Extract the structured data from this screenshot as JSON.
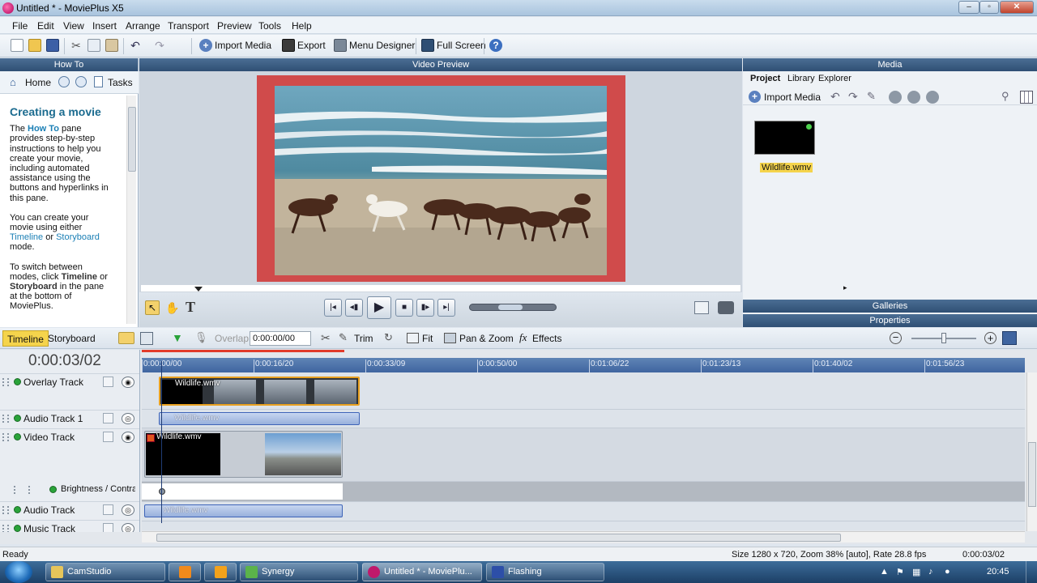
{
  "window": {
    "title": "Untitled * - MoviePlus X5",
    "min": "–",
    "max": "▫",
    "close": "✕"
  },
  "menu": [
    "File",
    "Edit",
    "View",
    "Insert",
    "Arrange",
    "Transport",
    "Preview",
    "Tools",
    "Help"
  ],
  "toolbar": {
    "import_media": "Import Media",
    "export": "Export",
    "menu_designer": "Menu Designer",
    "full_screen": "Full Screen"
  },
  "howto": {
    "header": "How To",
    "home": "Home",
    "tasks": "Tasks",
    "heading": "Creating a movie",
    "p1_a": "The ",
    "p1_b": "How To",
    "p1_c": " pane provides step-by-step instructions to help you create your movie, including automated assistance using the buttons and hyperlinks in this pane.",
    "p2_a": "You can create your movie using either ",
    "p2_link1": "Timeline",
    "p2_b": " or ",
    "p2_link2": "Storyboard",
    "p2_c": " mode.",
    "p3_a": "To switch between modes, click ",
    "p3_b": "Timeline",
    "p3_c": " or ",
    "p3_d": "Storyboard",
    "p3_e": " in the pane at the bottom of MoviePlus."
  },
  "preview": {
    "header": "Video Preview"
  },
  "media": {
    "header": "Media",
    "tabs": [
      "Project",
      "Library",
      "Explorer"
    ],
    "import_media": "Import Media",
    "file_name": "Wildlife.wmv",
    "galleries": "Galleries",
    "properties": "Properties"
  },
  "timeline_toolbar": {
    "timeline": "Timeline",
    "storyboard": "Storyboard",
    "overlap_label": "Overlap",
    "overlap_value": "0:00:00/00",
    "trim": "Trim",
    "fit": "Fit",
    "pan_zoom": "Pan & Zoom",
    "effects": "Effects"
  },
  "timeline": {
    "timecode": "0:00:03/02",
    "ruler": [
      "0:00:00/00",
      "0:00:16/20",
      "0:00:33/09",
      "0:00:50/00",
      "0:01:06/22",
      "0:01:23/13",
      "0:01:40/02",
      "0:01:56/23"
    ],
    "tracks": [
      "Overlay Track",
      "Audio Track 1",
      "Video Track",
      "Brightness / Contrast",
      "Audio Track",
      "Music Track"
    ],
    "clip_name": "Wildlife.wmv"
  },
  "status": {
    "ready": "Ready",
    "info": "Size 1280 x 720, Zoom 38% [auto], Rate 28.8 fps",
    "time": "0:00:03/02"
  },
  "taskbar": {
    "items": [
      "CamStudio",
      "Synergy",
      "Untitled * - MoviePlu...",
      "Flashing"
    ],
    "clock": "20:45"
  },
  "colors": {
    "accent_yellow": "#f5d44c",
    "panel_header": "#2f4f74",
    "preview_border": "#d04b4b"
  }
}
